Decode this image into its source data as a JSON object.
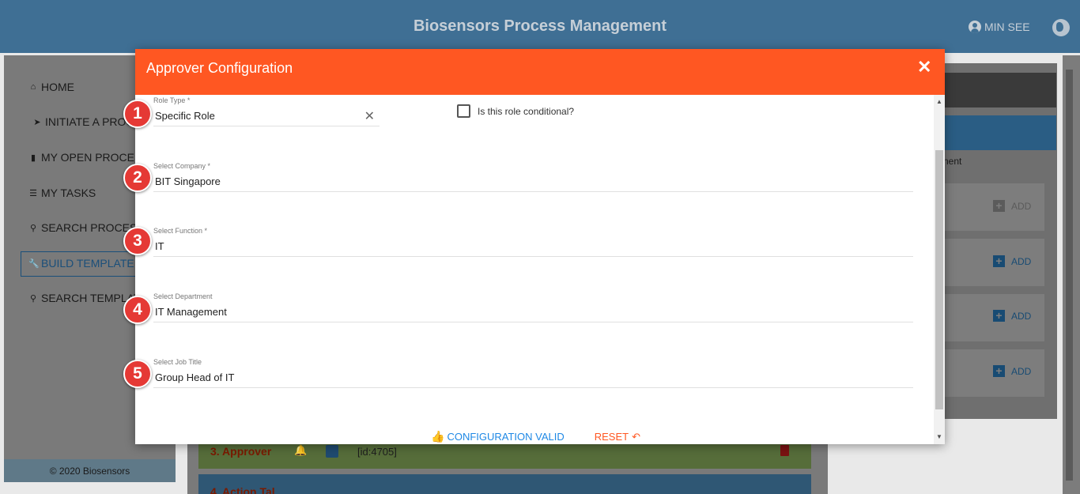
{
  "app": {
    "title": "Biosensors Process Management",
    "user": "MIN SEE"
  },
  "sidebar": {
    "items": [
      {
        "label": "HOME",
        "icon": "home-icon"
      },
      {
        "label": "INITIATE A PROCESS",
        "icon": "chevron-icon"
      },
      {
        "label": "MY OPEN PROCESSES",
        "icon": "file-icon"
      },
      {
        "label": "MY TASKS",
        "icon": "tasks-icon"
      },
      {
        "label": "SEARCH PROCESS",
        "icon": "search-icon"
      },
      {
        "label": "BUILD TEMPLATE",
        "icon": "wrench-icon",
        "active": true
      },
      {
        "label": "SEARCH TEMPLATE",
        "icon": "search-icon"
      }
    ],
    "footer": "© 2020 Biosensors"
  },
  "background": {
    "right_panel_text": "nent",
    "add_label": "ADD",
    "row1": {
      "label": "3. Approver",
      "id": "[id:4705]"
    },
    "row2": {
      "label": "4. Action Tal"
    }
  },
  "modal": {
    "title": "Approver Configuration",
    "close": "✕",
    "conditional_label": "Is this role conditional?",
    "fields": [
      {
        "label": "Role Type *",
        "value": "Specific Role",
        "badge": "1"
      },
      {
        "label": "Select Company *",
        "value": "BIT Singapore",
        "badge": "2"
      },
      {
        "label": "Select Function *",
        "value": "IT",
        "badge": "3"
      },
      {
        "label": "Select Department",
        "value": "IT Management",
        "badge": "4"
      },
      {
        "label": "Select Job Title",
        "value": "Group Head of IT",
        "badge": "5"
      }
    ],
    "actions": {
      "valid": "CONFIGURATION VALID",
      "reset": "RESET"
    }
  },
  "colors": {
    "header": "#3f6f94",
    "modal_header": "#ff5722",
    "badge": "#e53935",
    "valid": "#1e88e5"
  }
}
